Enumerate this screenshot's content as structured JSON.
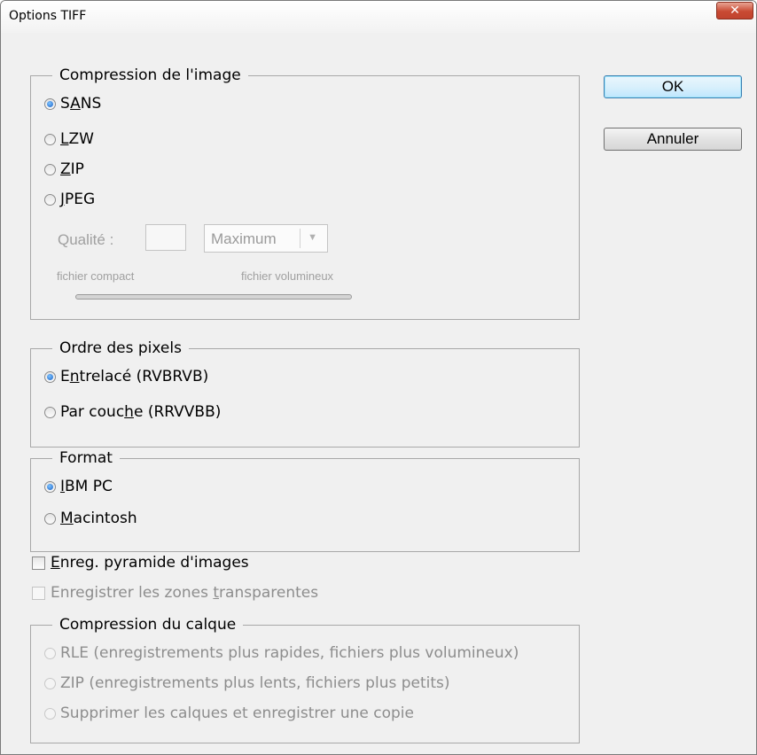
{
  "window": {
    "title": "Options TIFF",
    "close_label": "✕"
  },
  "buttons": {
    "ok": "OK",
    "cancel": "Annuler"
  },
  "image_compression": {
    "legend": "Compression de l'image",
    "options": [
      {
        "pre": "S",
        "key": "A",
        "post": "NS",
        "checked": true
      },
      {
        "pre": "",
        "key": "L",
        "post": "ZW",
        "checked": false
      },
      {
        "pre": "",
        "key": "Z",
        "post": "IP",
        "checked": false
      },
      {
        "pre": "",
        "key": "J",
        "post": "PEG",
        "checked": false
      }
    ],
    "quality_label": "Qualité :",
    "quality_value": "",
    "quality_select": "Maximum",
    "compact_label": "fichier compact",
    "large_label": "fichier volumineux"
  },
  "pixel_order": {
    "legend": "Ordre des pixels",
    "options": [
      {
        "pre": "E",
        "key": "n",
        "post": "trelacé (RVBRVB)",
        "checked": true
      },
      {
        "pre": "Par couc",
        "key": "h",
        "post": "e (RRVVBB)",
        "checked": false
      }
    ]
  },
  "format": {
    "legend": "Format",
    "options": [
      {
        "pre": "",
        "key": "I",
        "post": "BM PC",
        "checked": true
      },
      {
        "pre": "",
        "key": "M",
        "post": "acintosh",
        "checked": false
      }
    ]
  },
  "checkboxes": {
    "pyramid": {
      "pre": "",
      "key": "E",
      "post": "nreg. pyramide d'images",
      "checked": false
    },
    "transparency": {
      "pre": "Enregistrer les zones ",
      "key": "t",
      "post": "ransparentes",
      "checked": false
    }
  },
  "layer_compression": {
    "legend": "Compression du calque",
    "options": [
      "RLE (enregistrements plus rapides, fichiers plus volumineux)",
      "ZIP (enregistrements plus lents, fichiers plus petits)",
      "Supprimer les calques et enregistrer une copie"
    ]
  }
}
